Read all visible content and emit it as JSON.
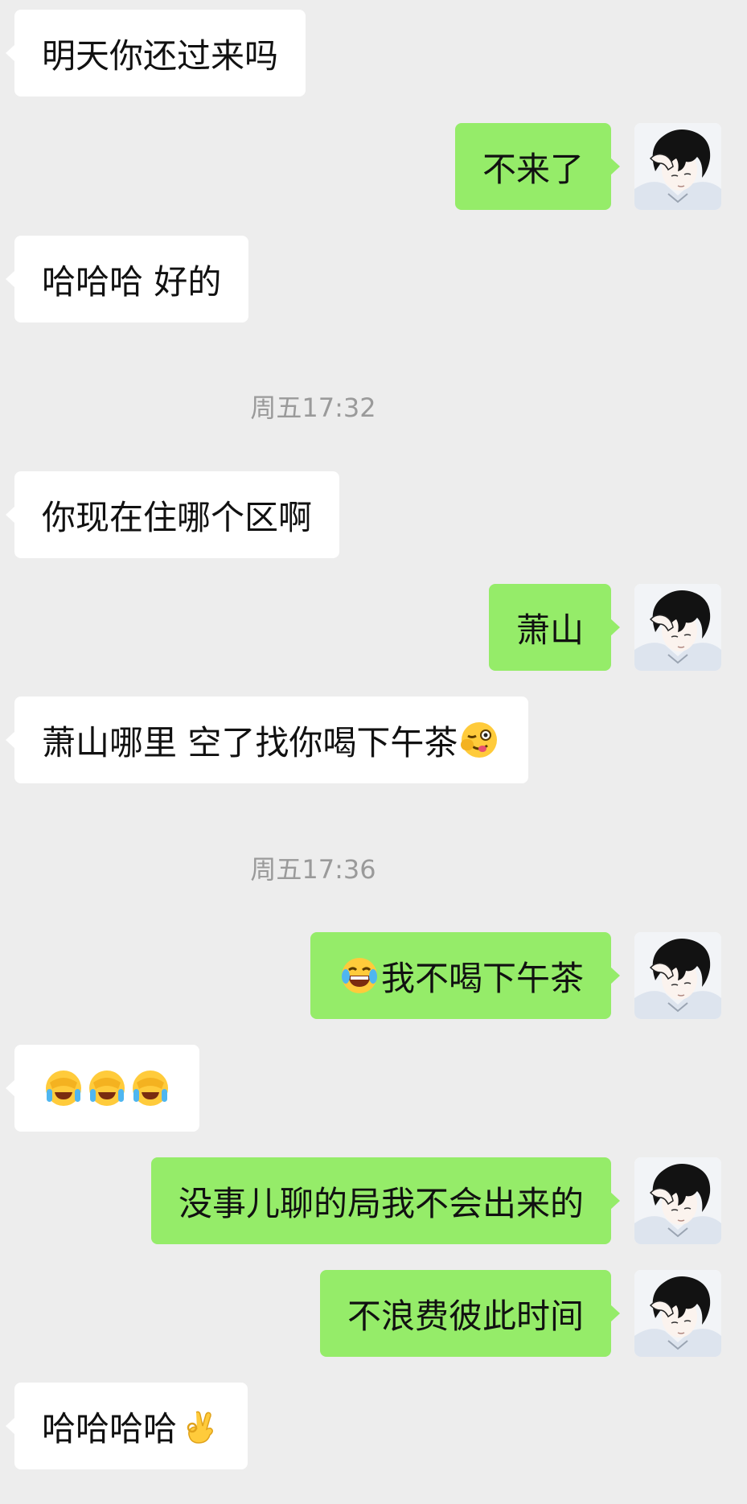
{
  "messages": [
    {
      "side": "in",
      "parts": [
        {
          "t": "明天你还过来吗"
        }
      ]
    },
    {
      "side": "out",
      "parts": [
        {
          "t": "不来了"
        }
      ]
    },
    {
      "side": "in",
      "parts": [
        {
          "t": "哈哈哈 好的"
        }
      ]
    },
    {
      "side": "in",
      "parts": [
        {
          "t": "你现在住哪个区啊"
        }
      ]
    },
    {
      "side": "out",
      "parts": [
        {
          "t": "萧山"
        }
      ]
    },
    {
      "side": "in",
      "parts": [
        {
          "t": "萧山哪里 空了找你喝下午茶"
        },
        {
          "icon": "wink-tongue-emoji-icon"
        }
      ]
    },
    {
      "side": "out",
      "parts": [
        {
          "icon": "laugh-tears-emoji-icon"
        },
        {
          "t": "我不喝下午茶"
        }
      ]
    },
    {
      "side": "in",
      "parts": [
        {
          "icon": "facepalm-cry-emoji-icon"
        },
        {
          "icon": "facepalm-cry-emoji-icon"
        },
        {
          "icon": "facepalm-cry-emoji-icon"
        }
      ]
    },
    {
      "side": "out",
      "parts": [
        {
          "t": "没事儿聊的局我不会出来的"
        }
      ]
    },
    {
      "side": "out",
      "parts": [
        {
          "t": "不浪费彼此时间"
        }
      ]
    },
    {
      "side": "in",
      "parts": [
        {
          "t": "哈哈哈哈 "
        },
        {
          "icon": "ok-hand-emoji-icon"
        }
      ]
    }
  ],
  "timestamps": [
    "周五17:32",
    "周五17:36"
  ],
  "avatar_icon": "anime-boy-avatar-icon",
  "colors": {
    "background": "#ededed",
    "incoming_bubble": "#ffffff",
    "outgoing_bubble": "#95ec69",
    "timestamp_text": "#9a9a9a"
  }
}
